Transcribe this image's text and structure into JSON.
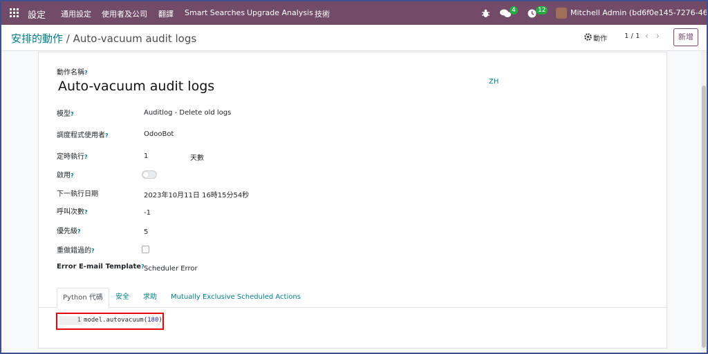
{
  "navbar": {
    "brand": "設定",
    "menu": [
      "通用設定",
      "使用者及公司",
      "翻譯",
      "Smart Searches",
      "Upgrade Analysis",
      "技術"
    ],
    "messages_count": "4",
    "activities_count": "12",
    "user": "Mitchell Admin (bd6f0e145-7276-46e3-..."
  },
  "breadcrumb": {
    "parent": "安排的動作",
    "separator": "/",
    "current": "Auto-vacuum audit logs"
  },
  "control": {
    "action_label": "動作",
    "pager": "1 / 1",
    "new_label": "新增"
  },
  "form": {
    "name_label": "動作名稱",
    "help_mark": "?",
    "title": "Auto-vacuum audit logs",
    "lang": "ZH",
    "fields": {
      "model": {
        "label": "模型",
        "value": "Auditlog - Delete old logs"
      },
      "user": {
        "label": "調度程式使用者",
        "value": "OdooBot"
      },
      "interval": {
        "label": "定時執行",
        "value": "1",
        "unit": "天數"
      },
      "active": {
        "label": "啟用",
        "checked": false
      },
      "nextcall": {
        "label": "下一執行日期",
        "value": "2023年10月11日 16時15分54秒"
      },
      "numbercall": {
        "label": "呼叫次數",
        "value": "-1"
      },
      "priority": {
        "label": "優先級",
        "value": "5"
      },
      "doall": {
        "label": "重做錯過的",
        "checked": false
      },
      "email_template": {
        "label": "Error E-mail Template",
        "value": "Scheduler Error"
      }
    },
    "tabs": [
      "Python 代碼",
      "安全",
      "求助",
      "Mutually Exclusive Scheduled Actions"
    ],
    "code": {
      "line_number": "1",
      "prefix": "model.autovacuum(",
      "arg": "180",
      "suffix": ")"
    }
  },
  "colors": {
    "navbar": "#714b67",
    "link": "#017e84",
    "highlight_box": "#e00000"
  }
}
